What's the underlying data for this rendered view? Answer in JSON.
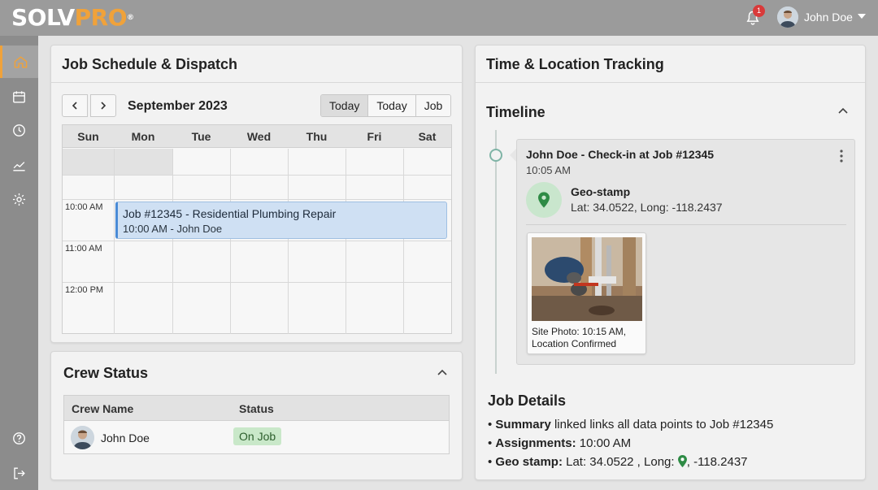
{
  "brand": {
    "name_part1": "SOLV",
    "name_part2": "PRO",
    "reg_mark": "®"
  },
  "colors": {
    "accent": "#f0a23a",
    "event": "#cfe0f3",
    "status_on_job": "#c9e8c9",
    "badge": "#d93a3a",
    "geo": "#2e8b45"
  },
  "header": {
    "notification_count": "1",
    "user_name": "John Doe"
  },
  "sidebar": {
    "items": [
      {
        "icon": "home-icon",
        "active": true
      },
      {
        "icon": "calendar-icon",
        "active": false
      },
      {
        "icon": "clock-icon",
        "active": false
      },
      {
        "icon": "chart-icon",
        "active": false
      },
      {
        "icon": "gear-icon",
        "active": false
      }
    ],
    "bottom_items": [
      {
        "icon": "help-icon"
      },
      {
        "icon": "logout-icon"
      }
    ]
  },
  "schedule": {
    "title": "Job Schedule & Dispatch",
    "month": "September 2023",
    "view_buttons": [
      "Today",
      "Today",
      "Job"
    ],
    "days": [
      "Sun",
      "Mon",
      "Tue",
      "Wed",
      "Thu",
      "Fri",
      "Sat"
    ],
    "times": [
      "10:00 AM",
      "11:00 AM",
      "12:00 PM"
    ],
    "event": {
      "title": "Job #12345 - Residential Plumbing Repair",
      "subtitle": "10:00 AM - John Doe"
    }
  },
  "crew": {
    "title": "Crew Status",
    "columns": [
      "Crew Name",
      "Status"
    ],
    "rows": [
      {
        "name": "John Doe",
        "status": "On Job"
      }
    ]
  },
  "tracking": {
    "title": "Time & Location Tracking",
    "timeline_title": "Timeline",
    "entry": {
      "title": "John Doe - Check-in at Job #12345",
      "time": "10:05 AM",
      "geo_label": "Geo-stamp",
      "geo_coords": "Lat: 34.0522, Long: -118.2437",
      "photo_caption_line1": "Site Photo: 10:15 AM,",
      "photo_caption_line2": "Location Confirmed"
    },
    "job_details": {
      "title": "Job Details",
      "summary_label": "Summary",
      "summary_text": " linked links all data points to Job #12345",
      "assignments_label": "Assignments:",
      "assignments_text": " 10:00 AM",
      "geo_label": "Geo stamp:",
      "geo_text_1": " Lat: 34.0522 , Long: ",
      "geo_text_2": ", -118.2437"
    }
  }
}
